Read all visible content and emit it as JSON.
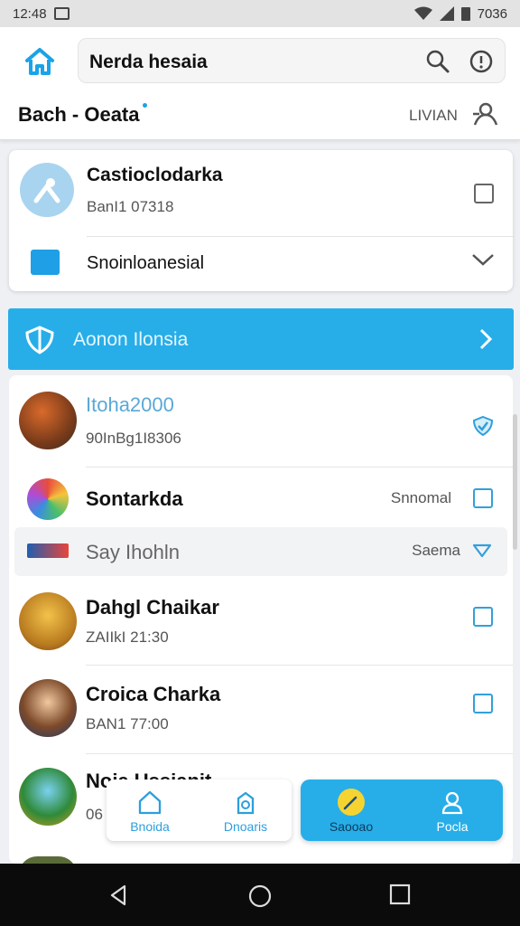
{
  "status_bar": {
    "time": "12:48",
    "right_text": "7036"
  },
  "app_bar": {
    "search_text": "Nerda hesaia",
    "subtitle": "Bach - Oeata",
    "user_label": "LIVIAN"
  },
  "card": {
    "title": "Castioclodarka",
    "subtitle": "BanI1 07318",
    "second_row": "Snoinloanesial"
  },
  "banner": {
    "label": "Aonon Ilonsia"
  },
  "list": [
    {
      "title": "Itoha2000",
      "subtitle": "90InBg1I8306",
      "meta": ""
    },
    {
      "title": "Sontarkda",
      "subtitle": "",
      "meta": "Snnomal"
    },
    {
      "title": "Say Ihohln",
      "subtitle": "",
      "meta": "Saema"
    },
    {
      "title": "Dahgl Chaikar",
      "subtitle": "ZAIIkI 21:30",
      "meta": ""
    },
    {
      "title": "Croica Charka",
      "subtitle": "BAN1 77:00",
      "meta": ""
    },
    {
      "title": "Noia Ussianit",
      "subtitle": "06",
      "meta": ""
    }
  ],
  "bottom_nav": {
    "items": [
      {
        "label": "Bnoida"
      },
      {
        "label": "Dnoaris"
      },
      {
        "label": "Saooao"
      },
      {
        "label": "Pocla"
      }
    ]
  },
  "colors": {
    "accent": "#27aee8",
    "check": "#33a0da",
    "nav_bar": "#0b0b0b"
  }
}
